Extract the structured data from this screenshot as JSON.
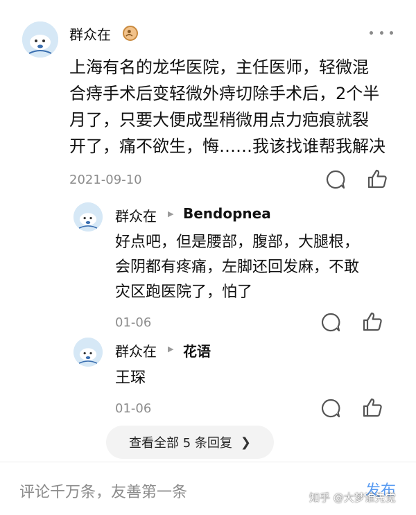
{
  "comment": {
    "author": "群众在",
    "badge_icon": "verified-badge-icon",
    "more_icon": "more-dots-icon",
    "text_lines": [
      "上海有名的龙华医院，主任医师，轻微混",
      "合痔手术后变轻微外痔切除手术后，2个半",
      "月了，只要大便成型稍微用点力疤痕就裂",
      "开了，痛不欲生，悔……我该找谁帮我解决"
    ],
    "date": "2021-09-10"
  },
  "replies": [
    {
      "author": "群众在",
      "reply_to": "Bendopnea",
      "text_lines": [
        "好点吧，但是腰部，腹部，大腿根，",
        "会阴都有疼痛，左脚还回发麻，不敢",
        "灾区跑医院了，怕了"
      ],
      "date": "01-06"
    },
    {
      "author": "群众在",
      "reply_to": "花语",
      "text_lines": [
        "王琛"
      ],
      "date": "01-06"
    }
  ],
  "view_all_label": "查看全部 5 条回复",
  "input": {
    "placeholder": "评论千万条，友善第一条"
  },
  "publish_label": "发布",
  "watermark": "知乎 @大梦谁先觉",
  "colors": {
    "accent": "#5a9cf2",
    "secondary_text": "#8c8c8c"
  }
}
